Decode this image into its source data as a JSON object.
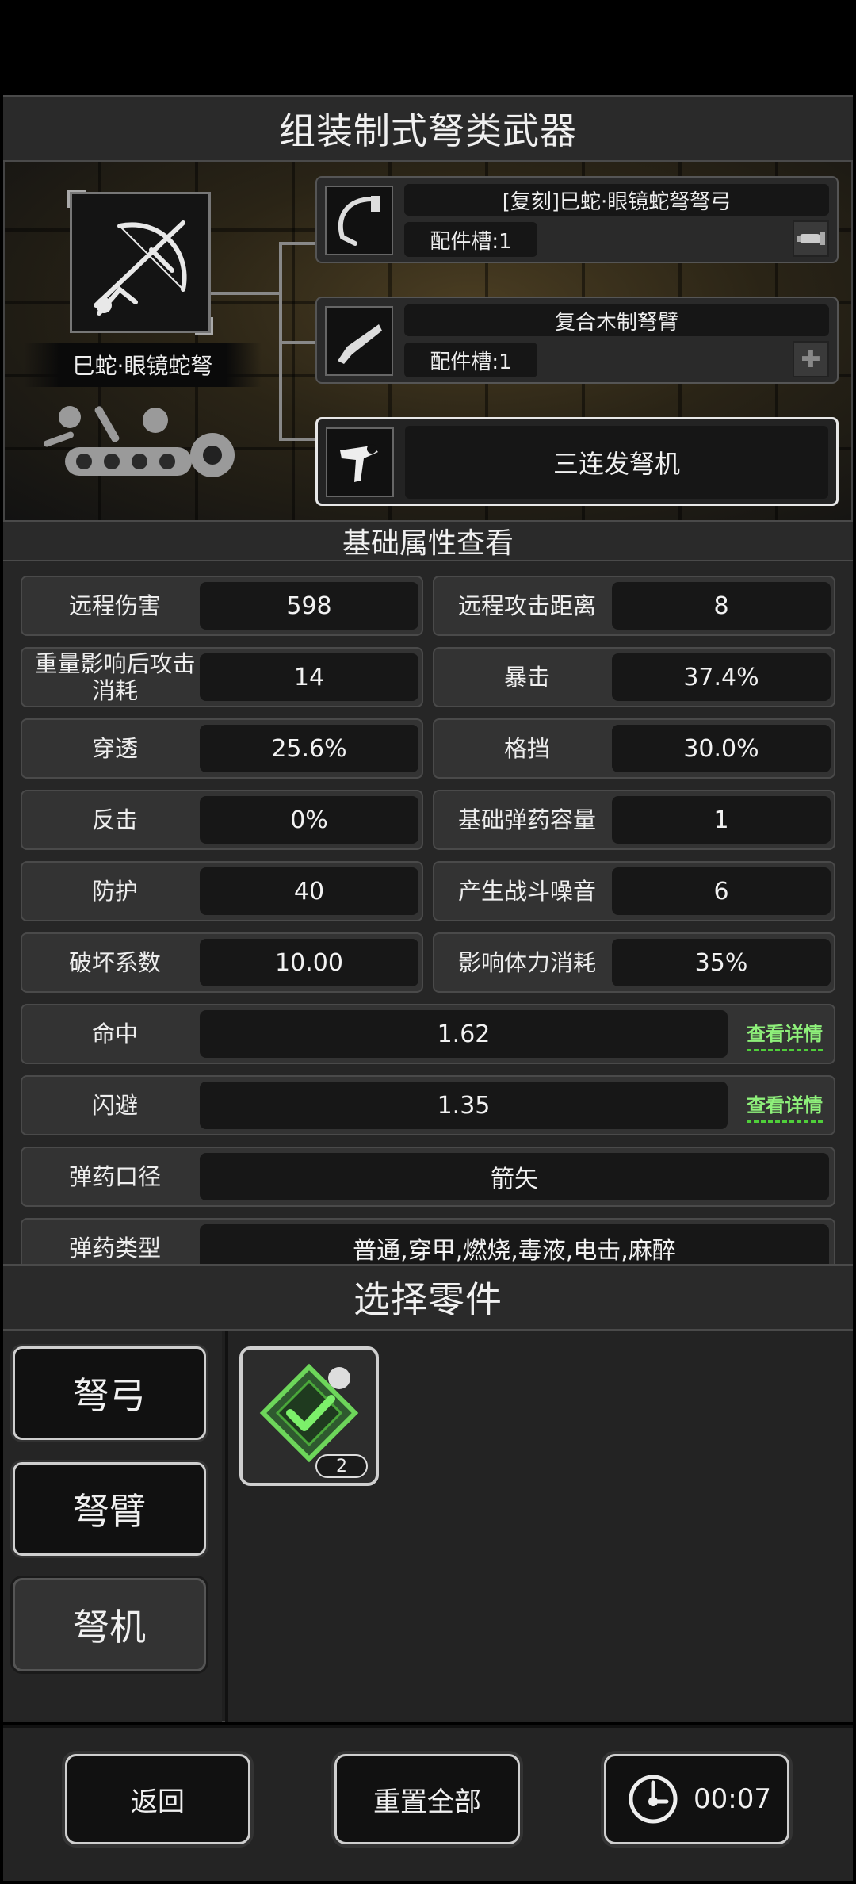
{
  "title": "组装制式弩类武器",
  "weapon": {
    "name": "巳蛇·眼镜蛇弩",
    "icon": "crossbow-icon"
  },
  "parts": [
    {
      "name": "[复刻]巳蛇·眼镜蛇弩弩弓",
      "slots": "配件槽:1",
      "icon": "bow-icon",
      "action_icon": "scope-icon"
    },
    {
      "name": "复合木制弩臂",
      "slots": "配件槽:1",
      "icon": "stock-icon",
      "action_icon": "plus-icon"
    },
    {
      "name": "三连发弩机",
      "icon": "trigger-icon",
      "selected": true
    }
  ],
  "stats_title": "基础属性查看",
  "stats_pairs": [
    [
      {
        "label": "远程伤害",
        "value": "598"
      },
      {
        "label": "远程攻击距离",
        "value": "8"
      }
    ],
    [
      {
        "label": "重量影响后攻击消耗",
        "value": "14"
      },
      {
        "label": "暴击",
        "value": "37.4%"
      }
    ],
    [
      {
        "label": "穿透",
        "value": "25.6%"
      },
      {
        "label": "格挡",
        "value": "30.0%"
      }
    ],
    [
      {
        "label": "反击",
        "value": "0%"
      },
      {
        "label": "基础弹药容量",
        "value": "1"
      }
    ],
    [
      {
        "label": "防护",
        "value": "40"
      },
      {
        "label": "产生战斗噪音",
        "value": "6"
      }
    ],
    [
      {
        "label": "破坏系数",
        "value": "10.00"
      },
      {
        "label": "影响体力消耗",
        "value": "35%"
      }
    ]
  ],
  "stats_wide": [
    {
      "label": "命中",
      "value": "1.62",
      "link": "查看详情"
    },
    {
      "label": "闪避",
      "value": "1.35",
      "link": "查看详情"
    },
    {
      "label": "弹药口径",
      "value": "箭矢"
    },
    {
      "label": "弹药类型",
      "value": "普通,穿甲,燃烧,毒液,电击,麻醉"
    }
  ],
  "select_title": "选择零件",
  "categories": [
    {
      "label": "弩弓"
    },
    {
      "label": "弩臂"
    },
    {
      "label": "弩机",
      "active": true
    }
  ],
  "items": [
    {
      "icon": "equipped-check-icon",
      "count": "2"
    }
  ],
  "bottom": {
    "back": "返回",
    "reset": "重置全部",
    "timer": "00:07"
  },
  "colors": {
    "accent_green": "#8ef07a",
    "panel": "#333333",
    "value_bg": "#171717"
  }
}
